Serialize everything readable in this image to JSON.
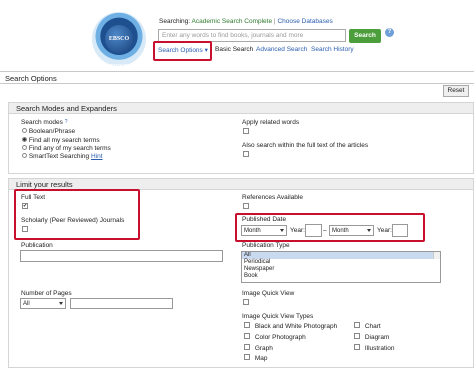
{
  "header": {
    "logo_text": "EBSCO HOST",
    "searching_label": "Searching:",
    "database": "Academic Search Complete",
    "separator": "|",
    "choose_databases": "Choose Databases",
    "search_placeholder": "Enter any words to find books, journals and more",
    "search_button": "Search",
    "help": "?",
    "nav": {
      "search_options": "Search Options ▾",
      "basic_search": "Basic Search",
      "advanced_search": "Advanced Search",
      "search_history": "Search History"
    }
  },
  "page": {
    "title": "Search Options",
    "reset": "Reset"
  },
  "modes": {
    "title": "Search Modes and Expanders",
    "search_modes_label": "Search modes",
    "hint": "?",
    "options": [
      {
        "label": "Boolean/Phrase",
        "selected": false
      },
      {
        "label": "Find all my search terms",
        "selected": true
      },
      {
        "label": "Find any of my search terms",
        "selected": false
      },
      {
        "label": "SmartText Searching",
        "selected": false
      }
    ],
    "hint_link": "Hint",
    "apply_related": "Apply related words",
    "also_search": "Also search within the full text of the articles"
  },
  "limit": {
    "title": "Limit your results",
    "full_text": "Full Text",
    "full_text_checked": "✔",
    "scholarly": "Scholarly (Peer Reviewed) Journals",
    "references": "References Available",
    "published_date": "Published Date",
    "month1": "Month",
    "year_label1": "Year:",
    "dash": "–",
    "month2": "Month",
    "year_label2": "Year:",
    "publication": "Publication",
    "publication_type": "Publication Type",
    "publication_types": [
      "All",
      "Periodical",
      "Newspaper",
      "Book"
    ],
    "number_of_pages": "Number of Pages",
    "pages_value": "All",
    "image_quick_view": "Image Quick View",
    "image_quick_view_types": "Image Quick View Types",
    "types_left": [
      "Black and White Photograph",
      "Color Photograph",
      "Graph",
      "Map"
    ],
    "types_right": [
      "Chart",
      "Diagram",
      "Illustration"
    ]
  },
  "colors": {
    "highlight": "#c8102e",
    "search_button": "#4c9e3c",
    "link": "#2a5db0",
    "database": "#2f7a2f"
  }
}
